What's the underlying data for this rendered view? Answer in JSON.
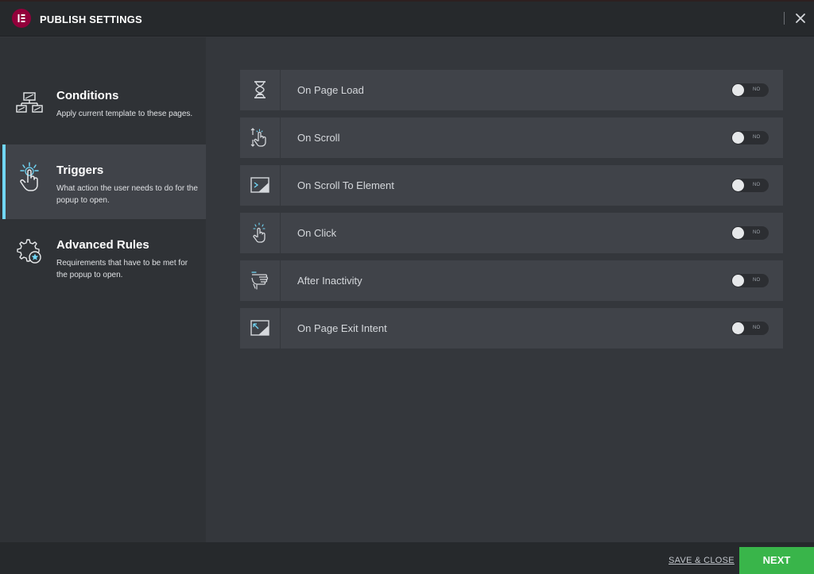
{
  "header": {
    "title": "PUBLISH SETTINGS",
    "logo_letter": "IE",
    "close_icon": "close-icon"
  },
  "sidebar": {
    "items": [
      {
        "title": "Conditions",
        "description": "Apply current template to these pages.",
        "icon": "sitemap-icon",
        "active": false
      },
      {
        "title": "Triggers",
        "description": "What action the user needs to do for the popup to open.",
        "icon": "tap-icon",
        "active": true
      },
      {
        "title": "Advanced Rules",
        "description": "Requirements that have to be met for the popup to open.",
        "icon": "gear-star-icon",
        "active": false
      }
    ]
  },
  "triggers": [
    {
      "label": "On Page Load",
      "icon": "hourglass-icon",
      "toggle": "NO"
    },
    {
      "label": "On Scroll",
      "icon": "scroll-hand-icon",
      "toggle": "NO"
    },
    {
      "label": "On Scroll To Element",
      "icon": "terminal-window-icon",
      "toggle": "NO"
    },
    {
      "label": "On Click",
      "icon": "click-hand-icon",
      "toggle": "NO"
    },
    {
      "label": "After Inactivity",
      "icon": "inactivity-hand-icon",
      "toggle": "NO"
    },
    {
      "label": "On Page Exit Intent",
      "icon": "exit-arrow-window-icon",
      "toggle": "NO"
    }
  ],
  "footer": {
    "save_close": "SAVE & CLOSE",
    "next": "NEXT"
  },
  "colors": {
    "accent": "#71d7f7",
    "next_button": "#39b54a",
    "logo": "#92003b"
  }
}
